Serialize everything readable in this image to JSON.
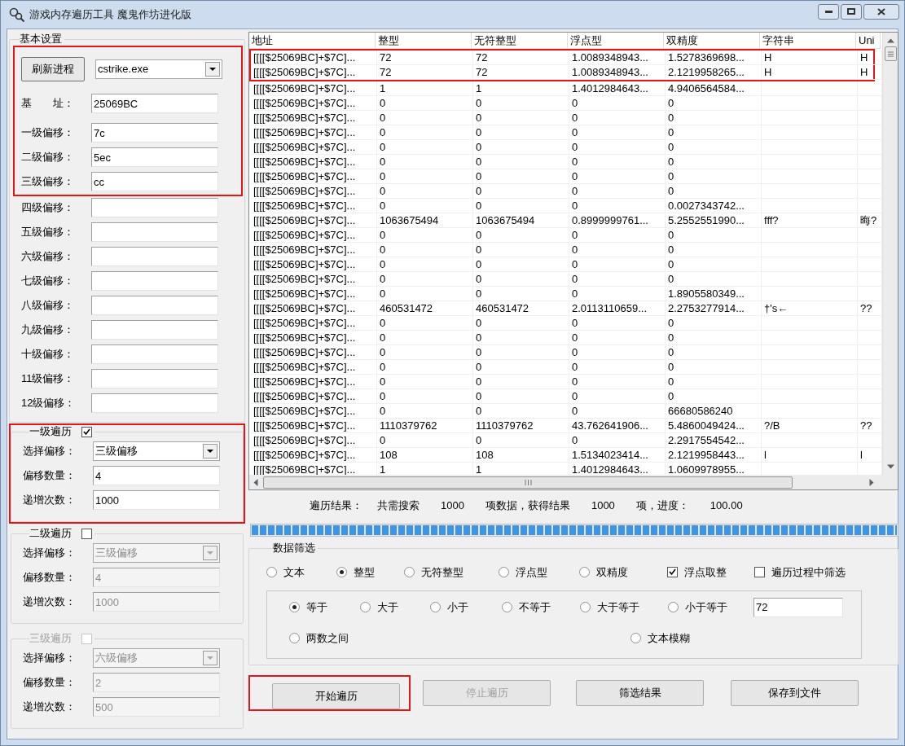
{
  "window": {
    "title": "游戏内存遍历工具 魔鬼作坊进化版"
  },
  "basic_settings": {
    "title": "基本设置",
    "highlighted": true,
    "refresh_button": "刷新进程",
    "process": "cstrike.exe",
    "main_fields": [
      {
        "label": "基　　址：",
        "value": "25069BC"
      },
      {
        "label": "一级偏移：",
        "value": "7c"
      },
      {
        "label": "二级偏移：",
        "value": "5ec"
      },
      {
        "label": "三级偏移：",
        "value": "cc"
      }
    ],
    "extra_fields": [
      {
        "label": "四级偏移："
      },
      {
        "label": "五级偏移："
      },
      {
        "label": "六级偏移："
      },
      {
        "label": "七级偏移："
      },
      {
        "label": "八级偏移："
      },
      {
        "label": "九级偏移："
      },
      {
        "label": "十级偏移："
      },
      {
        "label": "11级偏移："
      },
      {
        "label": "12级偏移："
      }
    ]
  },
  "traversals": [
    {
      "title": "一级遍历",
      "checked": true,
      "highlighted": true,
      "disabled": false,
      "title_disabled": false,
      "fields": [
        {
          "label": "选择偏移：",
          "value": "三级偏移",
          "kind": "dropdown"
        },
        {
          "label": "偏移数量：",
          "value": "4",
          "kind": "input"
        },
        {
          "label": "递增次数：",
          "value": "1000",
          "kind": "input"
        }
      ]
    },
    {
      "title": "二级遍历",
      "checked": false,
      "highlighted": false,
      "disabled": true,
      "title_disabled": false,
      "fields": [
        {
          "label": "选择偏移：",
          "value": "三级偏移",
          "kind": "dropdown"
        },
        {
          "label": "偏移数量：",
          "value": "4",
          "kind": "input"
        },
        {
          "label": "递增次数：",
          "value": "1000",
          "kind": "input"
        }
      ]
    },
    {
      "title": "三级遍历",
      "checked": false,
      "highlighted": false,
      "disabled": true,
      "title_disabled": true,
      "fields": [
        {
          "label": "选择偏移：",
          "value": "六级偏移",
          "kind": "dropdown"
        },
        {
          "label": "偏移数量：",
          "value": "2",
          "kind": "input"
        },
        {
          "label": "递增次数：",
          "value": "500",
          "kind": "input"
        }
      ]
    }
  ],
  "table": {
    "columns": [
      "地址",
      "整型",
      "无符整型",
      "浮点型",
      "双精度",
      "字符串",
      "Uni"
    ],
    "rows": [
      {
        "highlighted": true,
        "cells": [
          "[[[[$25069BC]+$7C]...",
          "72",
          "72",
          "1.0089348943...",
          "1.5278369698...",
          "H",
          "H"
        ]
      },
      {
        "highlighted": true,
        "cells": [
          "[[[[$25069BC]+$7C]...",
          "72",
          "72",
          "1.0089348943...",
          "2.1219958265...",
          "H",
          "H"
        ]
      },
      {
        "highlighted": false,
        "cells": [
          "[[[[$25069BC]+$7C]...",
          "1",
          "1",
          "1.4012984643...",
          "4.9406564584..."
        ]
      },
      {
        "highlighted": false,
        "cells": [
          "[[[[$25069BC]+$7C]...",
          "0",
          "0",
          "0",
          "0"
        ]
      },
      {
        "highlighted": false,
        "cells": [
          "[[[[$25069BC]+$7C]...",
          "0",
          "0",
          "0",
          "0"
        ]
      },
      {
        "highlighted": false,
        "cells": [
          "[[[[$25069BC]+$7C]...",
          "0",
          "0",
          "0",
          "0"
        ]
      },
      {
        "highlighted": false,
        "cells": [
          "[[[[$25069BC]+$7C]...",
          "0",
          "0",
          "0",
          "0"
        ]
      },
      {
        "highlighted": false,
        "cells": [
          "[[[[$25069BC]+$7C]...",
          "0",
          "0",
          "0",
          "0"
        ]
      },
      {
        "highlighted": false,
        "cells": [
          "[[[[$25069BC]+$7C]...",
          "0",
          "0",
          "0",
          "0"
        ]
      },
      {
        "highlighted": false,
        "cells": [
          "[[[[$25069BC]+$7C]...",
          "0",
          "0",
          "0",
          "0"
        ]
      },
      {
        "highlighted": false,
        "cells": [
          "[[[[$25069BC]+$7C]...",
          "0",
          "0",
          "0",
          "0.0027343742..."
        ]
      },
      {
        "highlighted": false,
        "cells": [
          "[[[[$25069BC]+$7C]...",
          "1063675494",
          "1063675494",
          "0.8999999761...",
          "5.2552551990...",
          "fff?",
          "晦?"
        ]
      },
      {
        "highlighted": false,
        "cells": [
          "[[[[$25069BC]+$7C]...",
          "0",
          "0",
          "0",
          "0"
        ]
      },
      {
        "highlighted": false,
        "cells": [
          "[[[[$25069BC]+$7C]...",
          "0",
          "0",
          "0",
          "0"
        ]
      },
      {
        "highlighted": false,
        "cells": [
          "[[[[$25069BC]+$7C]...",
          "0",
          "0",
          "0",
          "0"
        ]
      },
      {
        "highlighted": false,
        "cells": [
          "[[[[$25069BC]+$7C]...",
          "0",
          "0",
          "0",
          "0"
        ]
      },
      {
        "highlighted": false,
        "cells": [
          "[[[[$25069BC]+$7C]...",
          "0",
          "0",
          "0",
          "1.8905580349..."
        ]
      },
      {
        "highlighted": false,
        "cells": [
          "[[[[$25069BC]+$7C]...",
          "460531472",
          "460531472",
          "2.0113110659...",
          "2.2753277914...",
          "†'s←",
          "??"
        ]
      },
      {
        "highlighted": false,
        "cells": [
          "[[[[$25069BC]+$7C]...",
          "0",
          "0",
          "0",
          "0"
        ]
      },
      {
        "highlighted": false,
        "cells": [
          "[[[[$25069BC]+$7C]...",
          "0",
          "0",
          "0",
          "0"
        ]
      },
      {
        "highlighted": false,
        "cells": [
          "[[[[$25069BC]+$7C]...",
          "0",
          "0",
          "0",
          "0"
        ]
      },
      {
        "highlighted": false,
        "cells": [
          "[[[[$25069BC]+$7C]...",
          "0",
          "0",
          "0",
          "0"
        ]
      },
      {
        "highlighted": false,
        "cells": [
          "[[[[$25069BC]+$7C]...",
          "0",
          "0",
          "0",
          "0"
        ]
      },
      {
        "highlighted": false,
        "cells": [
          "[[[[$25069BC]+$7C]...",
          "0",
          "0",
          "0",
          "0"
        ]
      },
      {
        "highlighted": false,
        "cells": [
          "[[[[$25069BC]+$7C]...",
          "0",
          "0",
          "0",
          "66680586240"
        ]
      },
      {
        "highlighted": false,
        "cells": [
          "[[[[$25069BC]+$7C]...",
          "1110379762",
          "1110379762",
          "43.762641906...",
          "5.4860049424...",
          "?/B",
          "??"
        ]
      },
      {
        "highlighted": false,
        "cells": [
          "[[[[$25069BC]+$7C]...",
          "0",
          "0",
          "0",
          "2.2917554542..."
        ]
      },
      {
        "highlighted": false,
        "cells": [
          "[[[[$25069BC]+$7C]...",
          "108",
          "108",
          "1.5134023414...",
          "2.1219958443...",
          "l",
          "l"
        ]
      },
      {
        "highlighted": false,
        "cells": [
          "[[[[$25069BC]+$7C]...",
          "1",
          "1",
          "1.4012984643...",
          "1.0609978955..."
        ]
      }
    ]
  },
  "results": {
    "label": "遍历结果：",
    "parts": [
      "共需搜索",
      "1000",
      "项数据，获得结果",
      "1000",
      "项，进度：",
      "100.00"
    ],
    "progress": {
      "level": 1
    }
  },
  "filter": {
    "title": "数据筛选",
    "types": [
      {
        "label": "文本",
        "selected": false
      },
      {
        "label": "整型",
        "selected": true
      },
      {
        "label": "无符整型",
        "selected": false
      },
      {
        "label": "浮点型",
        "selected": false
      },
      {
        "label": "双精度",
        "selected": false
      }
    ],
    "options": [
      {
        "label": "浮点取整",
        "checked": true
      },
      {
        "label": "遍历过程中筛选",
        "checked": false
      }
    ],
    "conditions": [
      {
        "label": "等于",
        "selected": true
      },
      {
        "label": "大于",
        "selected": false
      },
      {
        "label": "小于",
        "selected": false
      },
      {
        "label": "不等于",
        "selected": false
      },
      {
        "label": "大于等于",
        "selected": false
      },
      {
        "label": "小于等于",
        "selected": false
      },
      {
        "label": "两数之间",
        "selected": false
      },
      {
        "label": "文本模糊",
        "selected": false
      }
    ],
    "value": "72"
  },
  "buttons": [
    {
      "label": "开始遍历",
      "disabled": false,
      "highlighted": true
    },
    {
      "label": "停止遍历",
      "disabled": true,
      "highlighted": false
    },
    {
      "label": "筛选结果",
      "disabled": false,
      "highlighted": false
    },
    {
      "label": "保存到文件",
      "disabled": false,
      "highlighted": false
    }
  ]
}
